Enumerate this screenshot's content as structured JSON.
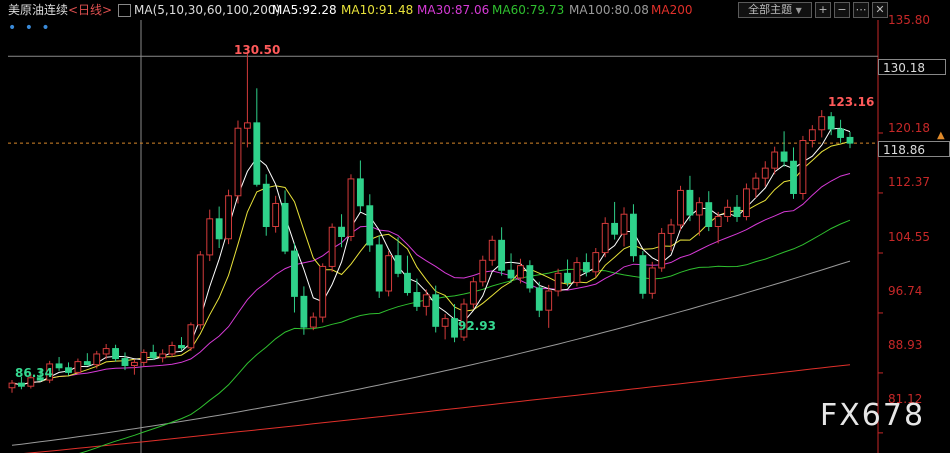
{
  "header": {
    "symbol_label": "美原油连续",
    "period_label": "<日线>",
    "ma_params": "MA(5,10,30,60,100,200)",
    "ma5": "MA5:92.28",
    "ma10": "MA10:91.48",
    "ma30": "MA30:87.06",
    "ma60": "MA60:79.73",
    "ma100": "MA100:80.08",
    "ma200": "MA200",
    "topic_button": "全部主题",
    "dots": "• • •"
  },
  "colors": {
    "up": "#d33b3b",
    "down": "#2fd18a",
    "ma5": "#ffffff",
    "ma10": "#e8e23a",
    "ma30": "#d63ad6",
    "ma60": "#2fbf2f",
    "ma100": "#9a9a9a",
    "ma200": "#e0302a",
    "axis_text": "#c62828",
    "grid": "#2a2a2a"
  },
  "icons": [
    "plus-square-icon",
    "minus-square-icon",
    "more-icon",
    "close-icon"
  ],
  "annotations": {
    "high1": "130.50",
    "low1": "86.34",
    "low2": "92.93",
    "high2": "123.16"
  },
  "price_box": "130.18",
  "current_box": "118.86",
  "watermark": "FX678",
  "chart_data": {
    "type": "candlestick",
    "ylim": [
      78.5,
      137.5
    ],
    "yticks": [
      "135.80",
      "120.18",
      "112.37",
      "104.55",
      "96.74",
      "88.93",
      "81.12"
    ],
    "yticks_values": [
      135.8,
      120.18,
      112.37,
      104.55,
      96.74,
      88.93,
      81.12
    ],
    "reference_line": 130.18,
    "current_price": 118.86,
    "candles": [
      [
        87.0,
        88.0,
        86.34,
        87.6
      ],
      [
        87.6,
        88.4,
        86.8,
        87.2
      ],
      [
        87.2,
        88.8,
        86.9,
        88.3
      ],
      [
        88.3,
        89.5,
        87.8,
        88.0
      ],
      [
        88.0,
        90.5,
        87.6,
        90.1
      ],
      [
        90.1,
        91.0,
        89.2,
        89.6
      ],
      [
        89.6,
        90.3,
        88.6,
        89.0
      ],
      [
        89.0,
        90.8,
        88.7,
        90.4
      ],
      [
        90.4,
        91.5,
        89.9,
        90.0
      ],
      [
        90.0,
        91.8,
        89.5,
        91.4
      ],
      [
        91.4,
        92.7,
        90.7,
        92.1
      ],
      [
        92.1,
        92.6,
        90.4,
        90.8
      ],
      [
        90.8,
        91.6,
        89.3,
        89.9
      ],
      [
        89.9,
        90.7,
        88.7,
        90.3
      ],
      [
        90.3,
        92.0,
        89.8,
        91.6
      ],
      [
        91.6,
        92.6,
        90.6,
        90.9
      ],
      [
        90.9,
        92.0,
        90.3,
        91.4
      ],
      [
        91.4,
        93.0,
        91.0,
        92.5
      ],
      [
        92.5,
        93.6,
        91.8,
        92.2
      ],
      [
        92.2,
        95.5,
        91.8,
        95.2
      ],
      [
        95.2,
        104.8,
        94.6,
        104.3
      ],
      [
        104.3,
        110.2,
        103.5,
        109.0
      ],
      [
        109.0,
        110.6,
        105.2,
        106.4
      ],
      [
        106.4,
        112.8,
        105.7,
        112.0
      ],
      [
        112.0,
        121.8,
        111.0,
        120.8
      ],
      [
        120.8,
        130.5,
        118.3,
        121.5
      ],
      [
        121.5,
        126.0,
        113.2,
        113.5
      ],
      [
        113.5,
        114.8,
        106.8,
        108.0
      ],
      [
        108.0,
        112.0,
        107.2,
        111.0
      ],
      [
        111.0,
        112.7,
        104.4,
        104.8
      ],
      [
        104.8,
        105.8,
        96.8,
        98.9
      ],
      [
        98.9,
        100.2,
        93.9,
        94.9
      ],
      [
        94.9,
        96.8,
        94.5,
        96.2
      ],
      [
        96.2,
        103.2,
        95.5,
        102.8
      ],
      [
        102.8,
        108.4,
        102.1,
        107.9
      ],
      [
        107.9,
        109.6,
        105.3,
        106.7
      ],
      [
        106.7,
        114.8,
        106.1,
        114.2
      ],
      [
        114.2,
        116.6,
        109.9,
        110.7
      ],
      [
        110.7,
        112.2,
        104.7,
        105.6
      ],
      [
        105.6,
        106.8,
        98.7,
        99.6
      ],
      [
        99.6,
        104.8,
        98.9,
        104.2
      ],
      [
        104.2,
        106.6,
        101.4,
        101.9
      ],
      [
        101.9,
        104.2,
        99.0,
        99.4
      ],
      [
        99.4,
        101.2,
        97.0,
        97.6
      ],
      [
        97.6,
        99.8,
        96.4,
        99.1
      ],
      [
        99.1,
        100.3,
        94.2,
        95.0
      ],
      [
        95.0,
        96.6,
        93.3,
        96.0
      ],
      [
        96.0,
        97.9,
        92.93,
        93.6
      ],
      [
        93.6,
        98.6,
        93.1,
        97.9
      ],
      [
        97.9,
        101.4,
        97.3,
        100.8
      ],
      [
        100.8,
        104.2,
        100.2,
        103.6
      ],
      [
        103.6,
        106.8,
        102.9,
        106.2
      ],
      [
        106.2,
        107.9,
        101.6,
        102.3
      ],
      [
        102.3,
        104.5,
        100.7,
        101.3
      ],
      [
        101.3,
        103.8,
        100.6,
        102.9
      ],
      [
        102.9,
        103.6,
        99.4,
        100.0
      ],
      [
        100.0,
        100.8,
        96.2,
        97.1
      ],
      [
        97.1,
        100.4,
        94.8,
        99.6
      ],
      [
        99.6,
        102.5,
        98.9,
        101.9
      ],
      [
        101.9,
        103.7,
        100.2,
        100.7
      ],
      [
        100.7,
        104.0,
        100.2,
        103.3
      ],
      [
        103.3,
        104.5,
        101.5,
        102.1
      ],
      [
        102.1,
        105.2,
        101.4,
        104.6
      ],
      [
        104.6,
        109.2,
        104.0,
        108.4
      ],
      [
        108.4,
        111.2,
        106.3,
        107.0
      ],
      [
        107.0,
        110.5,
        105.4,
        109.6
      ],
      [
        109.6,
        110.9,
        103.4,
        104.2
      ],
      [
        104.2,
        104.8,
        98.6,
        99.3
      ],
      [
        99.3,
        103.4,
        98.6,
        102.6
      ],
      [
        102.6,
        107.8,
        102.1,
        107.1
      ],
      [
        107.1,
        109.0,
        104.8,
        108.2
      ],
      [
        108.2,
        113.3,
        107.5,
        112.7
      ],
      [
        112.7,
        114.6,
        108.7,
        109.5
      ],
      [
        109.5,
        111.8,
        106.8,
        111.1
      ],
      [
        111.1,
        112.6,
        107.4,
        108.0
      ],
      [
        108.0,
        109.9,
        105.8,
        109.3
      ],
      [
        109.3,
        111.5,
        108.6,
        110.5
      ],
      [
        110.5,
        112.1,
        108.6,
        109.3
      ],
      [
        109.3,
        113.6,
        108.8,
        112.9
      ],
      [
        112.9,
        115.0,
        111.7,
        114.3
      ],
      [
        114.3,
        116.5,
        113.2,
        115.6
      ],
      [
        115.6,
        118.4,
        114.8,
        117.7
      ],
      [
        117.7,
        120.4,
        115.8,
        116.5
      ],
      [
        116.5,
        118.3,
        111.6,
        112.3
      ],
      [
        112.3,
        119.8,
        111.5,
        119.2
      ],
      [
        119.2,
        121.2,
        118.3,
        120.6
      ],
      [
        120.6,
        123.16,
        119.6,
        122.3
      ],
      [
        122.3,
        122.9,
        119.9,
        120.7
      ],
      [
        120.7,
        121.9,
        118.9,
        119.6
      ],
      [
        119.6,
        120.3,
        118.2,
        118.86
      ]
    ],
    "ma_lines": {
      "ma5": {
        "name": "MA5",
        "label_value": "92.28"
      },
      "ma10": {
        "name": "MA10",
        "label_value": "91.48"
      },
      "ma30": {
        "name": "MA30",
        "label_value": "87.06"
      },
      "ma60": {
        "name": "MA60",
        "label_value": "79.73"
      },
      "ma100": {
        "name": "MA100",
        "label_value": "80.08"
      },
      "ma200": {
        "name": "MA200",
        "label_value": ""
      }
    },
    "ma_anchors": {
      "ma60_start": 80.0,
      "ma100_start": 79.5,
      "ma200_start": 78.3,
      "ma200_end": 90.0,
      "ma100_end": 103.5
    }
  }
}
